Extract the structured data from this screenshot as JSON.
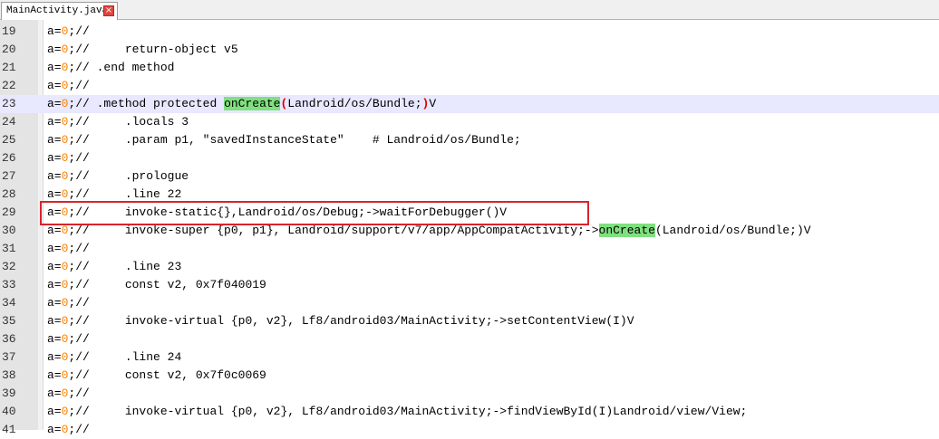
{
  "tab": {
    "filename": "MainActivity.java",
    "close_glyph": "×"
  },
  "editor": {
    "current_line": "23",
    "highlight_color": "#7fe07f",
    "lines": [
      {
        "n": "19",
        "pre": "a=",
        "num": "0",
        "post": ";//"
      },
      {
        "n": "20",
        "pre": "a=",
        "num": "0",
        "post": ";//     return-object v5"
      },
      {
        "n": "21",
        "pre": "a=",
        "num": "0",
        "post": ";// .end method"
      },
      {
        "n": "22",
        "pre": "a=",
        "num": "0",
        "post": ";//"
      },
      {
        "n": "23",
        "pre": "a=",
        "num": "0",
        "post": ";// .method protected ",
        "hl": "onCreate",
        "paren": "(",
        "rest": "Landroid/os/Bundle;",
        "paren2": ")",
        "tail": "V"
      },
      {
        "n": "24",
        "pre": "a=",
        "num": "0",
        "post": ";//     .locals 3"
      },
      {
        "n": "25",
        "pre": "a=",
        "num": "0",
        "post": ";//     .param p1, \"savedInstanceState\"    # Landroid/os/Bundle;"
      },
      {
        "n": "26",
        "pre": "a=",
        "num": "0",
        "post": ";//"
      },
      {
        "n": "27",
        "pre": "a=",
        "num": "0",
        "post": ";//     .prologue"
      },
      {
        "n": "28",
        "pre": "a=",
        "num": "0",
        "post": ";//     .line 22"
      },
      {
        "n": "29",
        "pre": "a=",
        "num": "0",
        "post": ";//     invoke-static{},Landroid/os/Debug;->waitForDebugger()V"
      },
      {
        "n": "30",
        "pre": "a=",
        "num": "0",
        "post": ";//     invoke-super {p0, p1}, Landroid/support/v7/app/AppCompatActivity;->",
        "hl": "onCreate",
        "rest": "(Landroid/os/Bundle;)V"
      },
      {
        "n": "31",
        "pre": "a=",
        "num": "0",
        "post": ";//"
      },
      {
        "n": "32",
        "pre": "a=",
        "num": "0",
        "post": ";//     .line 23"
      },
      {
        "n": "33",
        "pre": "a=",
        "num": "0",
        "post": ";//     const v2, 0x7f040019"
      },
      {
        "n": "34",
        "pre": "a=",
        "num": "0",
        "post": ";//"
      },
      {
        "n": "35",
        "pre": "a=",
        "num": "0",
        "post": ";//     invoke-virtual {p0, v2}, Lf8/android03/MainActivity;->setContentView(I)V"
      },
      {
        "n": "36",
        "pre": "a=",
        "num": "0",
        "post": ";//"
      },
      {
        "n": "37",
        "pre": "a=",
        "num": "0",
        "post": ";//     .line 24"
      },
      {
        "n": "38",
        "pre": "a=",
        "num": "0",
        "post": ";//     const v2, 0x7f0c0069"
      },
      {
        "n": "39",
        "pre": "a=",
        "num": "0",
        "post": ";//"
      },
      {
        "n": "40",
        "pre": "a=",
        "num": "0",
        "post": ";//     invoke-virtual {p0, v2}, Lf8/android03/MainActivity;->findViewById(I)Landroid/view/View;"
      },
      {
        "n": "41",
        "pre": "a=",
        "num": "0",
        "post": ";//"
      }
    ]
  }
}
